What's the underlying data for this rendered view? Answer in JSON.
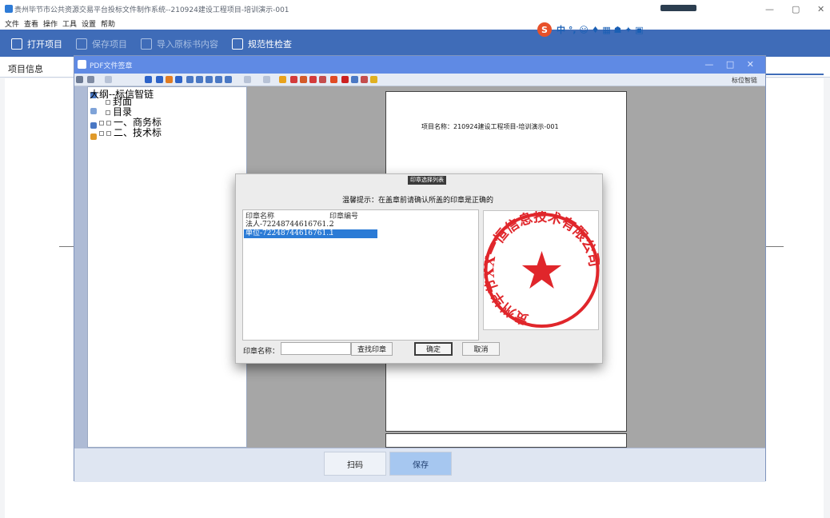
{
  "window": {
    "title": "贵州毕节市公共资源交易平台投标文件制作系统--210924建设工程项目-培训演示-001",
    "controls": [
      "—",
      "▢",
      "✕"
    ]
  },
  "menu": [
    "文件",
    "查看",
    "操作",
    "工具",
    "设置",
    "帮助"
  ],
  "toolbar": {
    "open_project": "打开项目",
    "save_project": "保存项目",
    "import_tender": "导入原标书内容",
    "compliance_check": "规范性检查"
  },
  "ime": {
    "logo": "S",
    "items": "中 °, ☺ ♦ ▦ ☗ ✦ ▣"
  },
  "tabs": {
    "project_info": "项目信息"
  },
  "pdf_window": {
    "title": "PDF文件签章",
    "controls": "— □ ✕",
    "tool_label": "标位智链",
    "tree": {
      "root": "大纲--标信智链",
      "items": [
        "封面",
        "目录",
        "一、商务标",
        "二、技术标"
      ]
    },
    "page_text": "项目名称：210924建设工程项目-培训演示-001",
    "scan_button": "扫码",
    "save_button": "保存"
  },
  "dialog": {
    "title": "印章选择列表",
    "tip": "温馨提示：在盖章前请确认所盖的印章是正确的",
    "columns": [
      "印章名称",
      "印章编号"
    ],
    "rows": [
      {
        "name": "法人-72248744616761...",
        "number": "2",
        "selected": false
      },
      {
        "name": "单位-72248744616761...",
        "number": "1",
        "selected": true
      }
    ],
    "stamp": {
      "text": "贵州毕节XX一恒信息技术有限公司",
      "color": "#e0262b"
    },
    "name_label": "印章名称：",
    "search_value": "",
    "find_button": "查找印章",
    "ok_button": "确定",
    "cancel_button": "取消"
  },
  "colors": {
    "toolbar_bg": "#3f6cb8",
    "pdf_title_bg": "#5f8ae4",
    "selection": "#2b7bd6",
    "stamp_red": "#e0262b"
  }
}
